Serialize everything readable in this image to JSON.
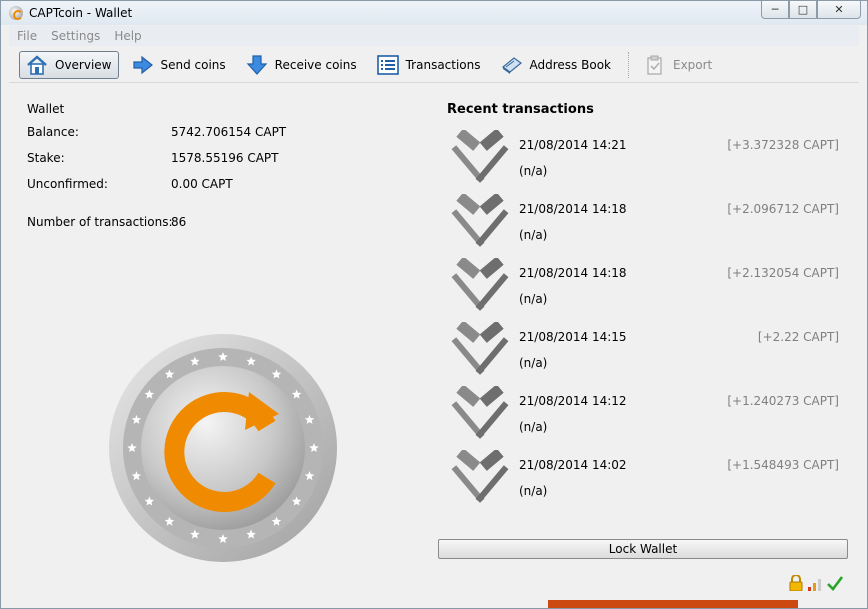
{
  "window": {
    "title": "CAPTcoin - Wallet",
    "minimize_glyph": "─",
    "maximize_glyph": "□",
    "close_glyph": "✕"
  },
  "menu": {
    "file": "File",
    "settings": "Settings",
    "help": "Help"
  },
  "toolbar": {
    "overview": "Overview",
    "send": "Send coins",
    "receive": "Receive coins",
    "transactions": "Transactions",
    "address_book": "Address Book",
    "export": "Export"
  },
  "wallet": {
    "heading": "Wallet",
    "balance_label": "Balance:",
    "balance_value": "5742.706154 CAPT",
    "stake_label": "Stake:",
    "stake_value": "1578.55196 CAPT",
    "unconfirmed_label": "Unconfirmed:",
    "unconfirmed_value": "0.00 CAPT",
    "num_tx_label": "Number of transactions:",
    "num_tx_value": "86"
  },
  "recent": {
    "title": "Recent transactions",
    "items": [
      {
        "date": "21/08/2014 14:21",
        "address": "(n/a)",
        "amount": "[+3.372328 CAPT]"
      },
      {
        "date": "21/08/2014 14:18",
        "address": "(n/a)",
        "amount": "[+2.096712 CAPT]"
      },
      {
        "date": "21/08/2014 14:18",
        "address": "(n/a)",
        "amount": "[+2.132054 CAPT]"
      },
      {
        "date": "21/08/2014 14:15",
        "address": "(n/a)",
        "amount": "[+2.22 CAPT]"
      },
      {
        "date": "21/08/2014 14:12",
        "address": "(n/a)",
        "amount": "[+1.240273 CAPT]"
      },
      {
        "date": "21/08/2014 14:02",
        "address": "(n/a)",
        "amount": "[+1.548493 CAPT]"
      }
    ]
  },
  "lock_button": "Lock Wallet",
  "colors": {
    "accent_orange": "#f08a00",
    "amount_gray": "#808080",
    "hammer_gray": "#8a8a8a"
  },
  "icons": {
    "tx": "mining-hammers-icon",
    "status": [
      "lock-icon",
      "signal-icon",
      "synced-check-icon"
    ]
  }
}
